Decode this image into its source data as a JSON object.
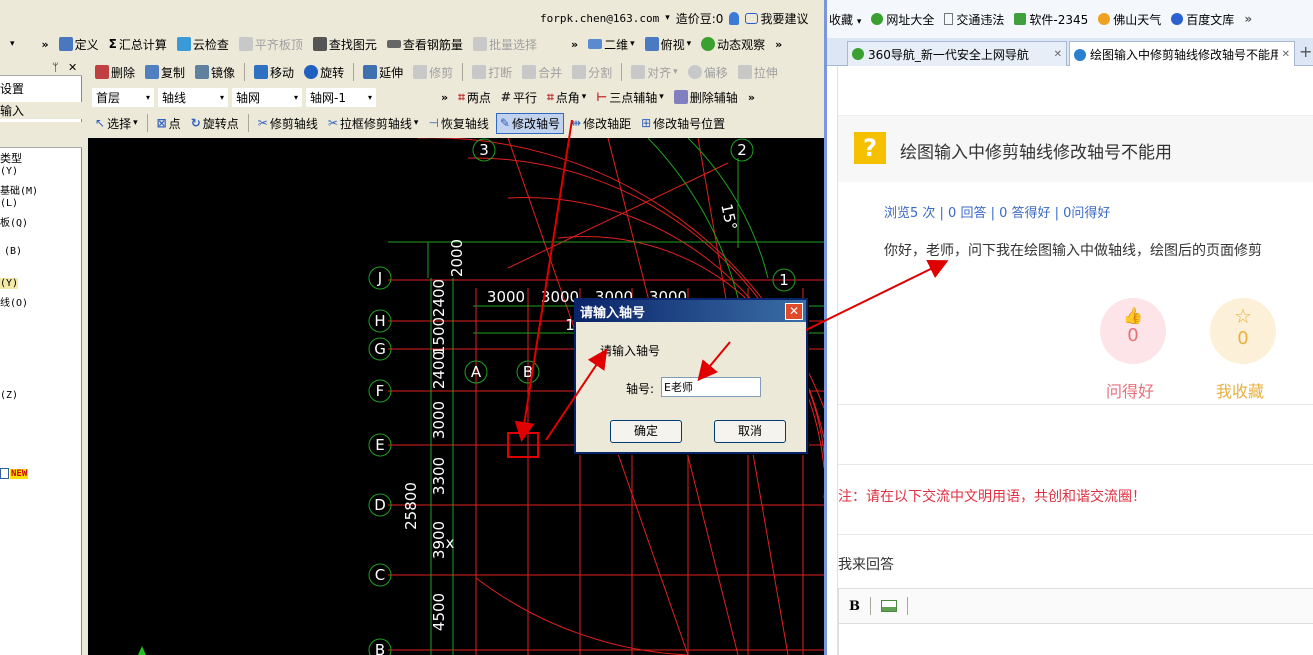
{
  "cad": {
    "user": {
      "email": "forpk.chen@163.com",
      "price_label": "造价豆:0",
      "suggest": "我要建议"
    },
    "toolbar1": {
      "dropdown_arrow": "▾",
      "chevron": "»",
      "items": [
        "定义",
        "汇总计算",
        "云检查",
        "平齐板顶",
        "查找图元",
        "查看钢筋量",
        "批量选择"
      ],
      "right": [
        "二维",
        "俯视",
        "动态观察"
      ]
    },
    "toolbar2": {
      "items": [
        "删除",
        "复制",
        "镜像",
        "移动",
        "旋转",
        "延伸",
        "修剪",
        "打断",
        "合并",
        "分割",
        "对齐",
        "偏移",
        "拉伸"
      ]
    },
    "toolbar3": {
      "selects": [
        "首层",
        "轴线",
        "轴网",
        "轴网-1"
      ],
      "items": [
        "两点",
        "平行",
        "点角",
        "三点辅轴",
        "删除辅轴"
      ]
    },
    "toolbar4": {
      "items": [
        "选择",
        "点",
        "旋转点",
        "修剪轴线",
        "拉框修剪轴线",
        "恢复轴线",
        "修改轴号",
        "修改轴距",
        "修改轴号位置"
      ]
    },
    "left_panel": {
      "pin": "ᛘ",
      "close": "✕",
      "rows": [
        "设置",
        "输入",
        "类型",
        "(Y)",
        "基础(M)",
        "(L)",
        "板(Q)",
        "(B)",
        "(Y)",
        "线(O)",
        "(Z)"
      ],
      "new_badge": "NEW"
    },
    "drawing": {
      "axis_letters": [
        "J",
        "H",
        "G",
        "F",
        "E",
        "D",
        "C",
        "B"
      ],
      "arc_letters": [
        "A",
        "B"
      ],
      "circle_numbers": [
        "3",
        "2",
        "1"
      ],
      "angle": "15°",
      "dim_top": [
        "3000",
        "3000",
        "3000",
        "3000"
      ],
      "dim_vertical": [
        "2000",
        "2400",
        "1500",
        "2400",
        "3000",
        "3300",
        "3900",
        "4500"
      ],
      "dim_total": "25800",
      "inner_one": "1",
      "marker": "x"
    },
    "dialog": {
      "title": "请输入轴号",
      "close": "✕",
      "prompt": "请输入轴号",
      "field_label": "轴号:",
      "field_value": "E老师",
      "ok": "确定",
      "cancel": "取消"
    }
  },
  "browser": {
    "bookmarks": [
      "收藏",
      "网址大全",
      "交通违法",
      "软件-2345",
      "佛山天气",
      "百度文库"
    ],
    "bm_arrow": "▾",
    "bm_more": "»",
    "tabs": [
      {
        "label": "360导航_新一代安全上网导航",
        "close": "✕"
      },
      {
        "label": "绘图输入中修剪轴线修改轴号不能用",
        "close": "✕"
      }
    ],
    "new_tab": "+",
    "question_mark": "?",
    "question_title": "绘图输入中修剪轴线修改轴号不能用",
    "stats": "浏览5 次 | 0 回答 | 0 答得好 | 0问得好",
    "body": "你好，老师，问下我在绘图输入中做轴线，绘图后的页面修剪",
    "like": {
      "icon": "👍",
      "count": "0",
      "label": "问得好"
    },
    "fav": {
      "icon": "☆",
      "count": "0",
      "label": "我收藏"
    },
    "notice": "注：请在以下交流中文明用语，共创和谐交流圈！",
    "answer_label": "我来回答",
    "editor": {
      "bold": "B"
    }
  },
  "colors": {
    "cad_bg": "#000000",
    "grid_red": "#e02020",
    "grid_green": "#20a020",
    "arrow_red": "#e00000",
    "dialog_title": "#0a246a"
  }
}
